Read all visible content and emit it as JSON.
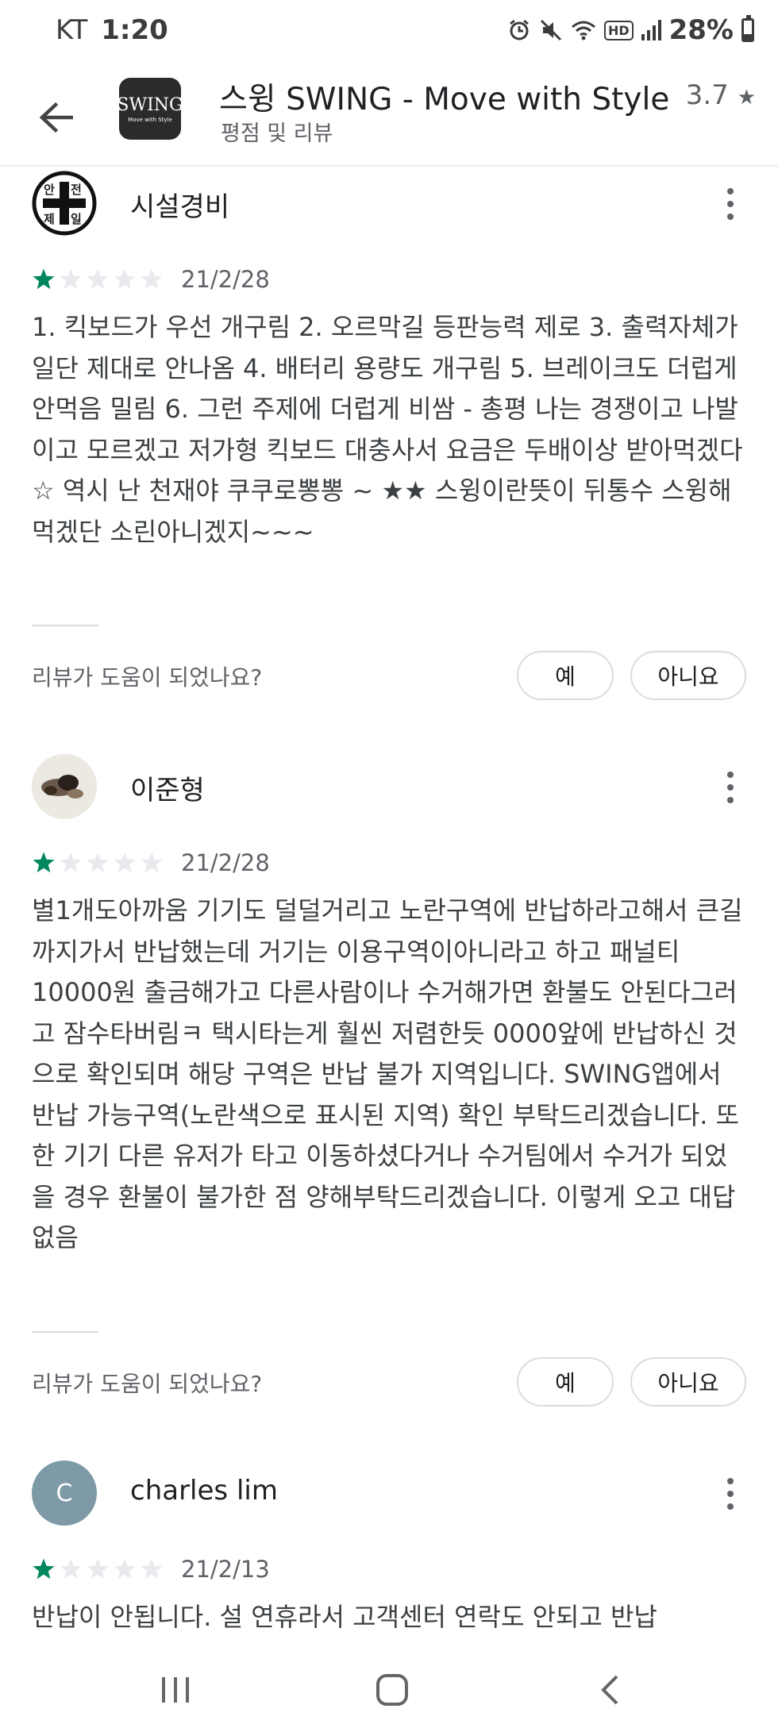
{
  "status_bar": {
    "carrier": "KT",
    "time": "1:20",
    "hd_label": "HD",
    "battery": "28%"
  },
  "header": {
    "app_title": "스윙 SWING - Move with Style",
    "rating": "3.7",
    "rating_star": "★",
    "subtitle": "평점 및 리뷰",
    "logo_main": "SWING",
    "logo_sub": "Move with Style"
  },
  "reviews": [
    {
      "author": "시설경비",
      "avatar_badge": [
        "안",
        "전",
        "제",
        "일"
      ],
      "stars": 1,
      "date": "21/2/28",
      "text": "1. 킥보드가 우선 개구림 2. 오르막길 등판능력 제로 3. 출력자체가 일단 제대로 안나옴 4. 배터리 용량도 개구림 5. 브레이크도 더럽게 안먹음 밀림 6. 그런 주제에 더럽게 비쌈 - 총평 나는 경쟁이고 나발이고 모르겠고 저가형 킥보드 대충사서 요금은 두배이상 받아먹겠다 ☆ 역시 난 천재야 쿠쿠로뽕뽕 ~ ★★ 스윙이란뜻이 뒤통수 스윙해먹겠단 소린아니겠지~~~",
      "helpful_question": "리뷰가 도움이 되었나요?",
      "yes_label": "예",
      "no_label": "아니요"
    },
    {
      "author": "이준형",
      "stars": 1,
      "date": "21/2/28",
      "text": "별1개도아까움 기기도 덜덜거리고 노란구역에 반납하라고해서 큰길까지가서 반납했는데 거기는 이용구역이아니라고 하고 패널티 10000원 출금해가고 다른사람이나 수거해가면 환불도 안된다그러고 잠수타버림ㅋ 택시타는게 훨씬 저렴한듯 0000앞에 반납하신 것으로 확인되며 해당 구역은 반납 불가 지역입니다. SWING앱에서 반납 가능구역(노란색으로 표시된 지역) 확인 부탁드리겠습니다. 또한 기기 다른 유저가 타고 이동하셨다거나 수거팀에서 수거가 되었을 경우 환불이 불가한 점 양해부탁드리겠습니다. 이렇게 오고 대답없음",
      "helpful_question": "리뷰가 도움이 되었나요?",
      "yes_label": "예",
      "no_label": "아니요"
    },
    {
      "author": "charles lim",
      "avatar_letter": "C",
      "stars": 1,
      "date": "21/2/13",
      "text": "반납이 안됩니다. 설 연휴라서 고객센터 연락도 안되고 반납"
    }
  ],
  "colors": {
    "star_filled": "#01875f",
    "star_empty": "#e8eaed",
    "avatar_c": "#7e9aa6"
  },
  "icons": {
    "back": "arrow-back-icon",
    "more": "more-vert-icon",
    "nav_recents": "recents-icon",
    "nav_home": "home-icon",
    "nav_back": "nav-back-icon"
  }
}
